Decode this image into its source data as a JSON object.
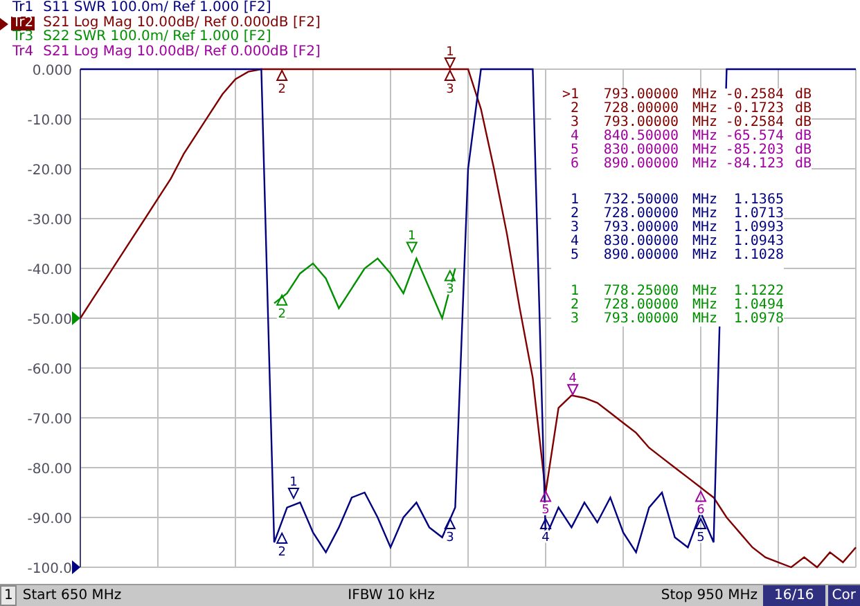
{
  "traces": [
    {
      "label": "Tr1",
      "text": "S11 SWR 100.0m/ Ref 1.000 [F2]",
      "color": "#000080",
      "selected": false
    },
    {
      "label": "Tr2",
      "text": "S21 Log Mag 10.00dB/ Ref 0.000dB [F2]",
      "color": "#800000",
      "selected": true
    },
    {
      "label": "Tr3",
      "text": "S22 SWR 100.0m/ Ref 1.000 [F2]",
      "color": "#009000",
      "selected": false
    },
    {
      "label": "Tr4",
      "text": "S21 Log Mag 10.00dB/ Ref 0.000dB [F2]",
      "color": "#a000a0",
      "selected": false
    }
  ],
  "chart": {
    "chart_data": {
      "type": "line",
      "grid": true,
      "categories": [
        null,
        null,
        null,
        null,
        null,
        null,
        null,
        null,
        null,
        null,
        null,
        null,
        null,
        null,
        null,
        null,
        null,
        null,
        null,
        null,
        null,
        null,
        null,
        null,
        null,
        null,
        null,
        null,
        null,
        null,
        null,
        null,
        null,
        null,
        null,
        null,
        null,
        null,
        null,
        null,
        null,
        null,
        null,
        null,
        null,
        null,
        null,
        null,
        null,
        null,
        null,
        null,
        null,
        null,
        null,
        null,
        null,
        null,
        null,
        null,
        null
      ],
      "ylim": [
        -100,
        0
      ],
      "yticks": [
        {
          "value": 0,
          "label": "0.000"
        },
        {
          "value": -10,
          "label": "-10.00"
        },
        {
          "value": -20,
          "label": "-20.00"
        },
        {
          "value": -30,
          "label": "-30.00"
        },
        {
          "value": -40,
          "label": "-40.00"
        },
        {
          "value": -50,
          "label": "-50.00"
        },
        {
          "value": -60,
          "label": "-60.00"
        },
        {
          "value": -70,
          "label": "-70.00"
        },
        {
          "value": -80,
          "label": "-80.00"
        },
        {
          "value": -90,
          "label": "-90.00"
        },
        {
          "value": -100,
          "label": "-100.0"
        }
      ],
      "series": [
        {
          "color": "#009000",
          "values": [
            null,
            null,
            null,
            null,
            null,
            null,
            null,
            null,
            null,
            null,
            null,
            null,
            null,
            null,
            null,
            -47,
            -45,
            -41,
            -39,
            -42,
            -48,
            -44,
            -40,
            -38,
            -41,
            -45,
            -38,
            -44,
            -50,
            -40,
            null,
            null,
            null,
            null,
            null,
            null,
            null,
            null,
            null,
            null,
            null,
            null,
            null,
            null,
            null,
            null,
            null,
            null,
            null,
            null,
            null,
            null,
            null,
            null,
            null,
            null,
            null,
            null,
            null,
            null,
            null
          ]
        },
        {
          "color": "#800000",
          "values": [
            -50,
            -46,
            -42,
            -38,
            -34,
            -30,
            -26,
            -22,
            -17,
            -13,
            -9,
            -5,
            -2,
            -0.5,
            0,
            0,
            0,
            0,
            0,
            0,
            0,
            0,
            0,
            0,
            0,
            0,
            0,
            0,
            0,
            0,
            0,
            -8,
            -20,
            -33,
            -48,
            -62,
            -85,
            -68,
            -65.5,
            -66,
            -67,
            -69,
            -71,
            -73,
            -76,
            -78,
            -80,
            -82,
            -84,
            -86,
            -90,
            -93,
            -96,
            -98,
            -99,
            -100,
            -98,
            -100,
            -97,
            -99,
            -96
          ]
        },
        {
          "color": "#000080",
          "values": [
            0,
            0,
            0,
            0,
            0,
            0,
            0,
            0,
            0,
            0,
            0,
            0,
            0,
            0,
            0,
            -95,
            -88,
            -87,
            -93,
            -97,
            -92,
            -86,
            -85,
            -90,
            -96,
            -90,
            -87,
            -92,
            -94,
            -88,
            -20,
            0,
            0,
            0,
            0,
            0,
            -94,
            -88,
            -92,
            -87,
            -91,
            -86,
            -93,
            -97,
            -88,
            -85,
            -94,
            -96,
            -89,
            -95,
            0,
            0,
            0,
            0,
            0,
            0,
            0,
            0,
            0,
            0,
            0
          ]
        }
      ]
    },
    "markers": [
      {
        "label": "1",
        "color": "#800000"
      },
      {
        "label": "2",
        "color": "#800000"
      },
      {
        "label": "3",
        "color": "#800000"
      },
      {
        "label": "1",
        "color": "#009000"
      },
      {
        "label": "3",
        "color": "#009000"
      },
      {
        "label": "2",
        "color": "#009000"
      },
      {
        "label": "4",
        "color": "#a000a0"
      },
      {
        "label": "1",
        "color": "#000080"
      },
      {
        "label": "5",
        "color": "#a000a0"
      },
      {
        "label": "6",
        "color": "#a000a0"
      },
      {
        "label": "3",
        "color": "#000080"
      },
      {
        "label": "4",
        "color": "#000080"
      },
      {
        "label": "5",
        "color": "#000080"
      },
      {
        "label": "2",
        "color": "#000080"
      }
    ]
  },
  "marker_table": [
    {
      "color": "#800000",
      "rows": [
        {
          "number": ">1",
          "frequency": "793.00000",
          "unit": "MHz",
          "value": "-0.2584",
          "value_unit": "dB"
        },
        {
          "number": "2",
          "frequency": "728.00000",
          "unit": "MHz",
          "value": "-0.1723",
          "value_unit": "dB"
        },
        {
          "number": "3",
          "frequency": "793.00000",
          "unit": "MHz",
          "value": "-0.2584",
          "value_unit": "dB"
        }
      ]
    },
    {
      "color": "#a000a0",
      "rows": [
        {
          "number": "4",
          "frequency": "840.50000",
          "unit": "MHz",
          "value": "-65.574",
          "value_unit": "dB"
        },
        {
          "number": "5",
          "frequency": "830.00000",
          "unit": "MHz",
          "value": "-85.203",
          "value_unit": "dB"
        },
        {
          "number": "6",
          "frequency": "890.00000",
          "unit": "MHz",
          "value": "-84.123",
          "value_unit": "dB"
        }
      ]
    },
    {
      "color": "#000080",
      "gap": true,
      "rows": [
        {
          "number": "1",
          "frequency": "732.50000",
          "unit": "MHz",
          "value": "1.1365"
        },
        {
          "number": "2",
          "frequency": "728.00000",
          "unit": "MHz",
          "value": "1.0713"
        },
        {
          "number": "3",
          "frequency": "793.00000",
          "unit": "MHz",
          "value": "1.0993"
        },
        {
          "number": "4",
          "frequency": "830.00000",
          "unit": "MHz",
          "value": "1.0943"
        },
        {
          "number": "5",
          "frequency": "890.00000",
          "unit": "MHz",
          "value": "1.1028"
        }
      ]
    },
    {
      "color": "#009000",
      "gap": true,
      "rows": [
        {
          "number": "1",
          "frequency": "778.25000",
          "unit": "MHz",
          "value": "1.1222"
        },
        {
          "number": "2",
          "frequency": "728.00000",
          "unit": "MHz",
          "value": "1.0494"
        },
        {
          "number": "3",
          "frequency": "793.00000",
          "unit": "MHz",
          "value": "1.0978"
        }
      ]
    }
  ],
  "status_bar": {
    "channel": "1",
    "start": "Start 650 MHz",
    "ifbw": "IFBW 10 kHz",
    "stop": "Stop 950 MHz",
    "count": "16/16",
    "correction": "Cor"
  }
}
